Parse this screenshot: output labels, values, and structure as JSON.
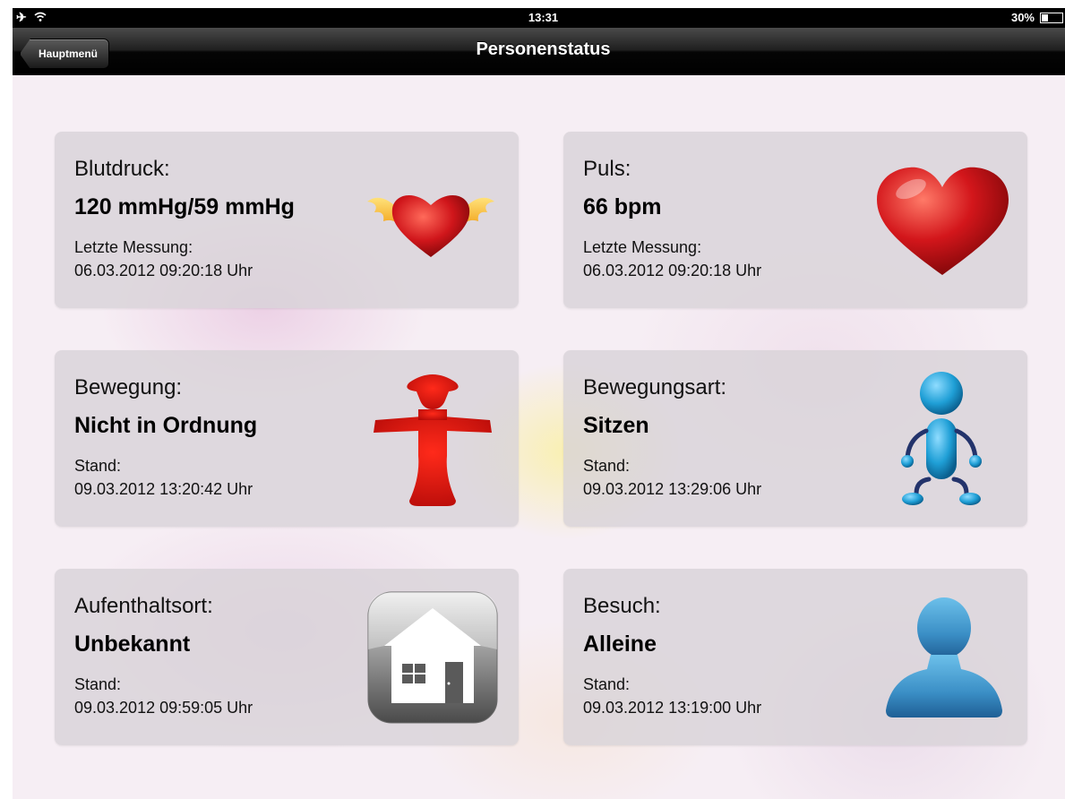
{
  "statusbar": {
    "time": "13:31",
    "battery_text": "30%",
    "battery_level": 0.3
  },
  "navbar": {
    "back_label": "Hauptmenü",
    "title": "Personenstatus"
  },
  "cards": [
    {
      "label": "Blutdruck:",
      "value": "120 mmHg/59 mmHg",
      "meta_label": "Letzte Messung:",
      "meta_value": "06.03.2012 09:20:18 Uhr",
      "icon": "winged-heart-icon"
    },
    {
      "label": "Puls:",
      "value": "66 bpm",
      "meta_label": "Letzte Messung:",
      "meta_value": "06.03.2012 09:20:18 Uhr",
      "icon": "heart-icon"
    },
    {
      "label": "Bewegung:",
      "value": "Nicht in Ordnung",
      "meta_label": "Stand:",
      "meta_value": "09.03.2012 13:20:42 Uhr",
      "icon": "red-figure-icon"
    },
    {
      "label": "Bewegungsart:",
      "value": "Sitzen",
      "meta_label": "Stand:",
      "meta_value": "09.03.2012 13:29:06 Uhr",
      "icon": "sitting-figure-icon"
    },
    {
      "label": "Aufenthaltsort:",
      "value": "Unbekannt",
      "meta_label": "Stand:",
      "meta_value": "09.03.2012 09:59:05 Uhr",
      "icon": "house-icon"
    },
    {
      "label": "Besuch:",
      "value": "Alleine",
      "meta_label": "Stand:",
      "meta_value": "09.03.2012 13:19:00 Uhr",
      "icon": "person-silhouette-icon"
    }
  ],
  "colors": {
    "heart_red": "#c8141a",
    "figure_blue": "#1f9fd6",
    "silhouette_blue": "#3b8fc6"
  }
}
